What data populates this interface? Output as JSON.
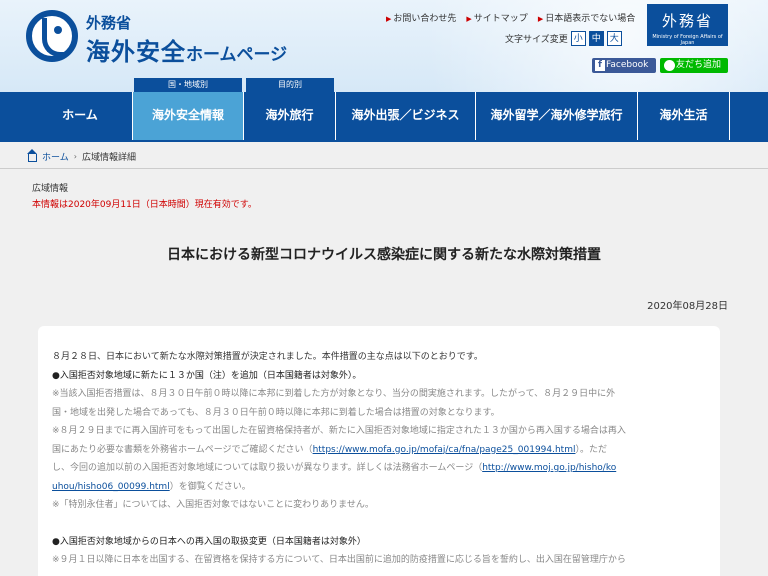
{
  "header": {
    "ministry": "外務省",
    "site_title": "海外安全",
    "site_title_sub": "ホームページ",
    "util_links": [
      "お問い合わせ先",
      "サイトマップ",
      "日本語表示でない場合"
    ],
    "font_size_label": "文字サイズ変更",
    "font_sizes": [
      "小",
      "中",
      "大"
    ],
    "mofa_box_big": "外務省",
    "mofa_box_small": "Ministry of Foreign Affairs of Japan",
    "facebook_label": "Facebook",
    "line_label": "友だち追加",
    "category_tabs": [
      "国・地域別",
      "目的別"
    ]
  },
  "nav": {
    "items": [
      "ホーム",
      "海外安全情報",
      "海外旅行",
      "海外出張／ビジネス",
      "海外留学／海外修学旅行",
      "海外生活"
    ],
    "active_index": 1
  },
  "breadcrumb": {
    "home": "ホーム",
    "current": "広域情報詳細"
  },
  "section_label": "広域情報",
  "valid_note": "本情報は2020年09月11日（日本時間）現在有効です。",
  "page_title": "日本における新型コロナウイルス感染症に関する新たな水際対策措置",
  "page_date": "2020年08月28日",
  "content": {
    "l1": "８月２８日、日本において新たな水際対策措置が決定されました。本件措置の主な点は以下のとおりです。",
    "l2": "●入国拒否対象地域に新たに１３か国（注）を追加（日本国籍者は対象外）。",
    "l3": "※当該入国拒否措置は、８月３０日午前０時以降に本邦に到着した方が対象となり、当分の間実施されます。したがって、８月２９日中に外",
    "l4": "国・地域を出発した場合であっても、８月３０日午前０時以降に本邦に到着した場合は措置の対象となります。",
    "l5": "※８月２９日までに再入国許可をもって出国した在留資格保持者が、新たに入国拒否対象地域に指定された１３か国から再入国する場合は再入",
    "l6a": "国にあたり必要な書類を外務省ホームページでご確認ください（",
    "l6_link": "https://www.mofa.go.jp/mofaj/ca/fna/page25_001994.html",
    "l6b": "）。ただ",
    "l7a": "し、今回の追加以前の入国拒否対象地域については取り扱いが異なります。詳しくは法務省ホームページ（",
    "l7_link": "http://www.moj.go.jp/hisho/ko",
    "l8_link": "uhou/hisho06_00099.html",
    "l8b": "）を御覧ください。",
    "l9": "※「特別永住者」については、入国拒否対象ではないことに変わりありません。",
    "l10": "●入国拒否対象地域からの日本への再入国の取扱変更（日本国籍者は対象外）",
    "l11": "※９月１日以降に日本を出国する、在留資格を保持する方について、日本出国前に追加的防疫措置に応じる旨を誓約し、出入国在留管理庁から"
  }
}
